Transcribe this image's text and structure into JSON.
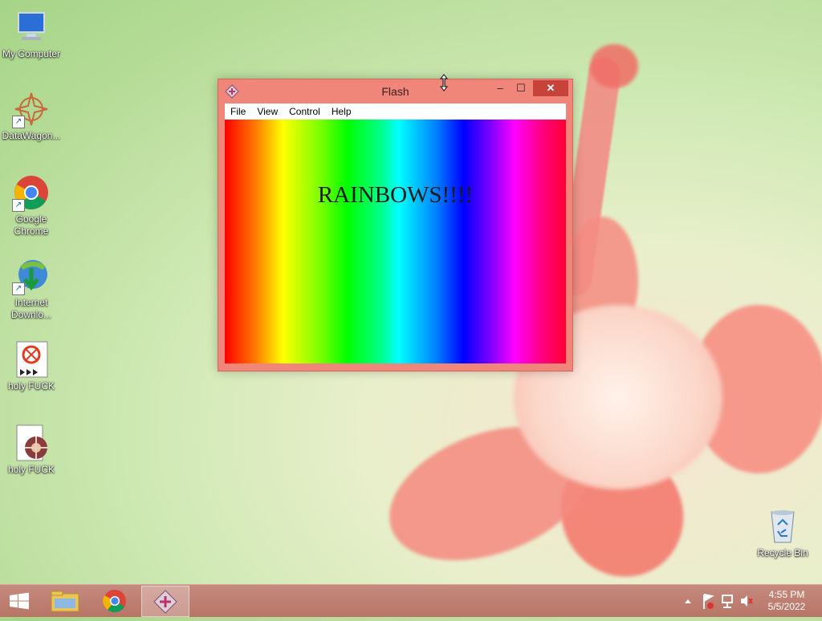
{
  "desktop": {
    "icons": [
      {
        "label": "My Computer",
        "icon": "computer-icon"
      },
      {
        "label": "DataWagon...",
        "icon": "datawagon-icon"
      },
      {
        "label": "Google Chrome",
        "icon": "chrome-icon"
      },
      {
        "label": "Internet Downlo...",
        "icon": "idm-icon"
      },
      {
        "label": "holy FUCK",
        "icon": "flash-file-icon"
      },
      {
        "label": "holy FUCK",
        "icon": "media-file-icon"
      },
      {
        "label": "Recycle Bin",
        "icon": "recycle-bin-icon"
      }
    ]
  },
  "window": {
    "title": "Flash",
    "menu": [
      "File",
      "View",
      "Control",
      "Help"
    ],
    "content_text": "RAINBOWS!!!!",
    "accent": "#f0857a"
  },
  "taskbar": {
    "items": [
      {
        "name": "file-explorer",
        "icon": "folder-icon"
      },
      {
        "name": "chrome",
        "icon": "chrome-icon"
      },
      {
        "name": "flash-player",
        "icon": "flash-icon",
        "active": true
      }
    ],
    "clock": {
      "time": "4:55 PM",
      "date": "5/5/2022"
    }
  }
}
